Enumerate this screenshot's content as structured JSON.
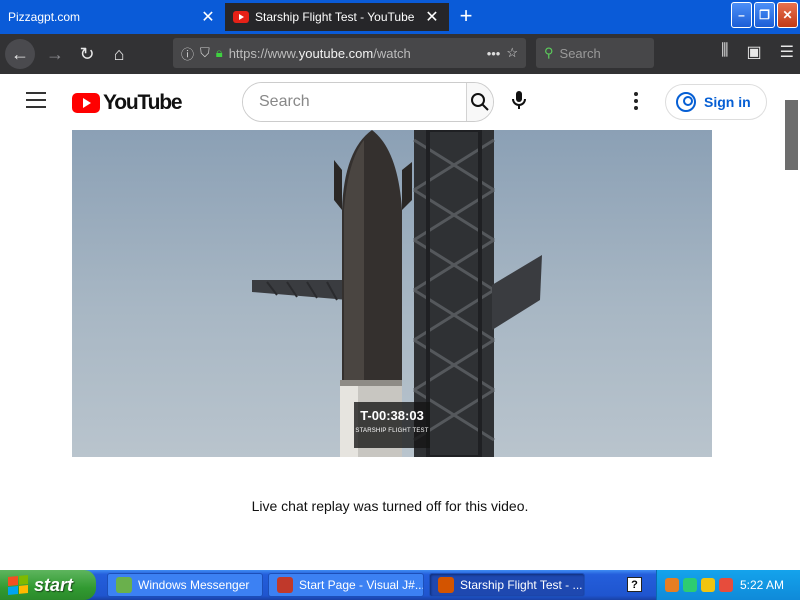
{
  "browser": {
    "tabs": [
      {
        "title": "Pizzagpt.com",
        "active": false
      },
      {
        "title": "Starship Flight Test - YouTube",
        "active": true
      }
    ],
    "url_prefix": "https://www.",
    "url_domain": "youtube.com",
    "url_suffix": "/watch",
    "search_placeholder": "Search"
  },
  "youtube": {
    "logo_text": "YouTube",
    "search_placeholder": "Search",
    "signin_label": "Sign in"
  },
  "video": {
    "countdown": "T-00:38:03",
    "overlay_subtitle": "STARSHIP FLIGHT TEST"
  },
  "chat": {
    "message": "Live chat replay was turned off for this video."
  },
  "taskbar": {
    "start_label": "start",
    "tasks": [
      {
        "label": "Windows Messenger"
      },
      {
        "label": "Start Page - Visual J#..."
      },
      {
        "label": "Starship Flight Test - ..."
      }
    ],
    "clock": "5:22 AM"
  },
  "colors": {
    "browser_tab_bg": "#0a5bd8",
    "active_tab_bg": "#262629",
    "navbar_bg": "#323234",
    "youtube_red": "#ff0000",
    "signin_blue": "#065fd4",
    "taskbar_blue": "#245edb",
    "start_green": "#319a31"
  }
}
